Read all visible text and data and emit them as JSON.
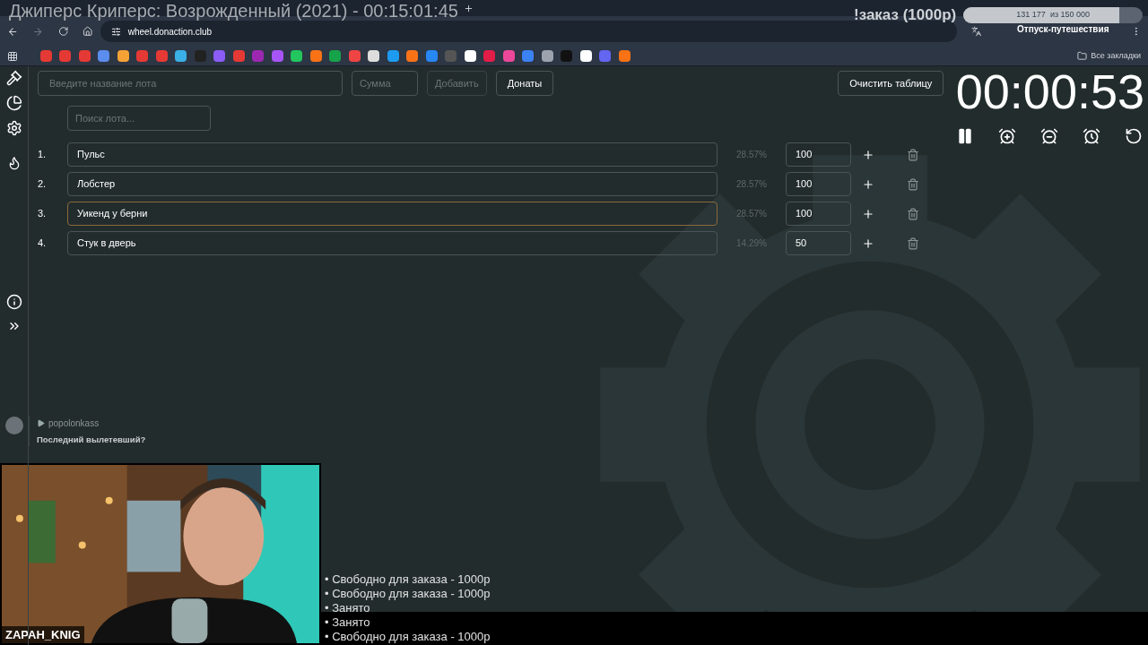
{
  "stream_title": "Джиперс Криперс: Возрожденный (2021) - 00:15:01:45",
  "browser": {
    "url": "wheel.donaction.club",
    "all_bookmarks": "Все закладки"
  },
  "goal": {
    "title": "!заказ (1000р)",
    "reading": "131 177  из 150 000",
    "level": 0.87,
    "caption": "Отпуск-путешествия"
  },
  "form": {
    "name_placeholder": "Введите название лота",
    "sum_placeholder": "Сумма",
    "add_button": "Добавить",
    "donations_button": "Донаты",
    "search_placeholder": "Поиск лота...",
    "clear_button": "Очистить таблицу"
  },
  "lots": [
    {
      "number": "1.",
      "name": "Пульс",
      "percent": "28.57%",
      "amount": "100",
      "focused": false
    },
    {
      "number": "2.",
      "name": "Лобстер",
      "percent": "28.57%",
      "amount": "100",
      "focused": false
    },
    {
      "number": "3.",
      "name": "Уикенд у берни",
      "percent": "28.57%",
      "amount": "100",
      "focused": true
    },
    {
      "number": "4.",
      "name": "Стук в дверь",
      "percent": "14.29%",
      "amount": "50",
      "focused": false
    }
  ],
  "timer": "00:00:53",
  "chat": {
    "user": "popolonkass",
    "message": "Последний вылетевший?"
  },
  "webcam": {
    "kind": "picture",
    "name": "ZAPAH_KNIG"
  },
  "order_slots": [
    "• Свободно для заказа - 1000р",
    "• Свободно для заказа - 1000р",
    "• Занято",
    "• Занято",
    "• Свободно для заказа - 1000р"
  ]
}
